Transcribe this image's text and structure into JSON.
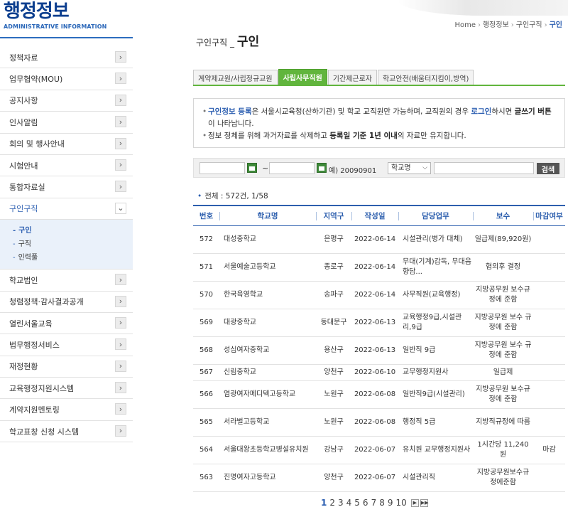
{
  "brand": {
    "title": "행정정보",
    "subtitle": "ADMINISTRATIVE INFORMATION"
  },
  "sidebar": {
    "items_top": [
      {
        "label": "정책자료"
      },
      {
        "label": "업무협약(MOU)"
      },
      {
        "label": "공지사항"
      },
      {
        "label": "인사알림"
      },
      {
        "label": "회의 및 행사안내"
      },
      {
        "label": "시험안내"
      },
      {
        "label": "통합자료실"
      }
    ],
    "active_item": {
      "label": "구인구직"
    },
    "submenu": [
      {
        "label": "구인"
      },
      {
        "label": "구직"
      },
      {
        "label": "인력풀"
      }
    ],
    "items_bottom": [
      {
        "label": "학교법인"
      },
      {
        "label": "청렴정책·감사결과공개"
      },
      {
        "label": "열린서울교육"
      },
      {
        "label": "법무행정서비스"
      },
      {
        "label": "재정현황"
      },
      {
        "label": "교육행정지원시스템"
      },
      {
        "label": "계약지원멘토링"
      },
      {
        "label": "학교표창 신청 시스템"
      }
    ]
  },
  "breadcrumb": {
    "home": "Home",
    "level1": "행정정보",
    "level2": "구인구직",
    "current": "구인"
  },
  "page_title": {
    "prefix": "구인구직 _",
    "main": "구인"
  },
  "tabs": [
    {
      "label": "계약제교원/사립정규교원",
      "active": false
    },
    {
      "label": "사립사무직원",
      "active": true
    },
    {
      "label": "기간제근로자",
      "active": false
    },
    {
      "label": "학교안전(배움터지킴이,방역)",
      "active": false
    }
  ],
  "info": {
    "line1_a": "구인정보 등록",
    "line1_b": "은 서울시교육청(산하기관) 및 학교 교직원만 가능하며, 교직원의 경우 ",
    "line1_c": "로그인",
    "line1_d": "하시면 ",
    "line1_e": "글쓰기 버튼",
    "line1_f": "이 나타납니다.",
    "line2_a": "정보 정체를 위해 과거자료를 삭제하고 ",
    "line2_b": "등록일 기준 1년 이내",
    "line2_c": "의 자료만 유지합니다."
  },
  "search": {
    "tilde": "~",
    "example": "예) 20090901",
    "select_value": "학교명",
    "button_label": "검색"
  },
  "total": {
    "text": "전체 : 572건, 1/58"
  },
  "table": {
    "headers": [
      "번호",
      "학교명",
      "지역구",
      "작성일",
      "담당업무",
      "보수",
      "마감여부"
    ],
    "rows": [
      {
        "no": "572",
        "school": "대성중학교",
        "district": "은평구",
        "date": "2022-06-14",
        "duty": "시설관리(병가 대체)",
        "pay": "일급제(89,920원)",
        "deadline": ""
      },
      {
        "no": "571",
        "school": "서울예술고등학교",
        "district": "종로구",
        "date": "2022-06-14",
        "duty": "무대(기계)감독, 무대음향담...",
        "pay": "협의후 결정",
        "deadline": ""
      },
      {
        "no": "570",
        "school": "한국육영학교",
        "district": "송파구",
        "date": "2022-06-14",
        "duty": "사무직원(교육행정)",
        "pay": "지방공무원 보수규정에 준함",
        "deadline": ""
      },
      {
        "no": "569",
        "school": "대광중학교",
        "district": "동대문구",
        "date": "2022-06-13",
        "duty": "교육행정9급,시설관리,9급",
        "pay": "지방공무원 보수 규정에 준함",
        "deadline": ""
      },
      {
        "no": "568",
        "school": "성심여자중학교",
        "district": "용산구",
        "date": "2022-06-13",
        "duty": "일반직 9급",
        "pay": "지방공무원 보수 규정에 준함",
        "deadline": ""
      },
      {
        "no": "567",
        "school": "신림중학교",
        "district": "양천구",
        "date": "2022-06-10",
        "duty": "교무행정지원사",
        "pay": "일급제",
        "deadline": ""
      },
      {
        "no": "566",
        "school": "염광여자메디텍고등학교",
        "district": "노원구",
        "date": "2022-06-08",
        "duty": "일반직9급(시설관리)",
        "pay": "지방공무원 보수규정에 준함",
        "deadline": ""
      },
      {
        "no": "565",
        "school": "서라벌고등학교",
        "district": "노원구",
        "date": "2022-06-08",
        "duty": "행정직 5급",
        "pay": "지방직규정에 따름",
        "deadline": ""
      },
      {
        "no": "564",
        "school": "서울대왕초등학교병설유치원",
        "district": "강남구",
        "date": "2022-06-07",
        "duty": "유치원 교무행정지원사",
        "pay": "1시간당 11,240원",
        "deadline": "마감"
      },
      {
        "no": "563",
        "school": "진명여자고등학교",
        "district": "양천구",
        "date": "2022-06-07",
        "duty": "시설관리직",
        "pay": "지방공무원보수규정에준함",
        "deadline": ""
      }
    ]
  },
  "pagination": {
    "pages": [
      "1",
      "2",
      "3",
      "4",
      "5",
      "6",
      "7",
      "8",
      "9",
      "10"
    ],
    "current": "1",
    "next_icon": "next-page-icon",
    "last_icon": "last-page-icon"
  },
  "colors": {
    "brand_blue": "#0d3f8f",
    "accent_blue": "#2a5db0",
    "tab_green": "#61b53d"
  }
}
